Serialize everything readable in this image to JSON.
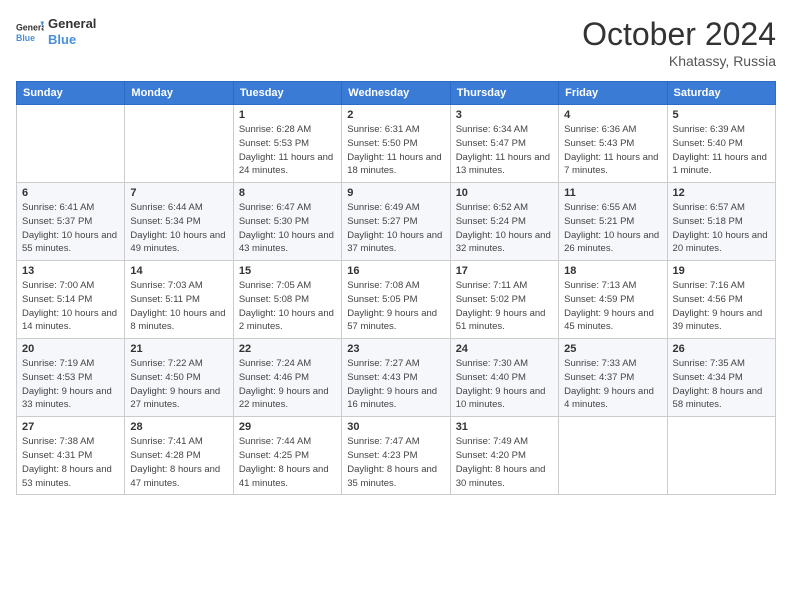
{
  "header": {
    "logo_line1": "General",
    "logo_line2": "Blue",
    "month": "October 2024",
    "location": "Khatassy, Russia"
  },
  "weekdays": [
    "Sunday",
    "Monday",
    "Tuesday",
    "Wednesday",
    "Thursday",
    "Friday",
    "Saturday"
  ],
  "weeks": [
    [
      {
        "day": "",
        "info": ""
      },
      {
        "day": "",
        "info": ""
      },
      {
        "day": "1",
        "info": "Sunrise: 6:28 AM\nSunset: 5:53 PM\nDaylight: 11 hours and 24 minutes."
      },
      {
        "day": "2",
        "info": "Sunrise: 6:31 AM\nSunset: 5:50 PM\nDaylight: 11 hours and 18 minutes."
      },
      {
        "day": "3",
        "info": "Sunrise: 6:34 AM\nSunset: 5:47 PM\nDaylight: 11 hours and 13 minutes."
      },
      {
        "day": "4",
        "info": "Sunrise: 6:36 AM\nSunset: 5:43 PM\nDaylight: 11 hours and 7 minutes."
      },
      {
        "day": "5",
        "info": "Sunrise: 6:39 AM\nSunset: 5:40 PM\nDaylight: 11 hours and 1 minute."
      }
    ],
    [
      {
        "day": "6",
        "info": "Sunrise: 6:41 AM\nSunset: 5:37 PM\nDaylight: 10 hours and 55 minutes."
      },
      {
        "day": "7",
        "info": "Sunrise: 6:44 AM\nSunset: 5:34 PM\nDaylight: 10 hours and 49 minutes."
      },
      {
        "day": "8",
        "info": "Sunrise: 6:47 AM\nSunset: 5:30 PM\nDaylight: 10 hours and 43 minutes."
      },
      {
        "day": "9",
        "info": "Sunrise: 6:49 AM\nSunset: 5:27 PM\nDaylight: 10 hours and 37 minutes."
      },
      {
        "day": "10",
        "info": "Sunrise: 6:52 AM\nSunset: 5:24 PM\nDaylight: 10 hours and 32 minutes."
      },
      {
        "day": "11",
        "info": "Sunrise: 6:55 AM\nSunset: 5:21 PM\nDaylight: 10 hours and 26 minutes."
      },
      {
        "day": "12",
        "info": "Sunrise: 6:57 AM\nSunset: 5:18 PM\nDaylight: 10 hours and 20 minutes."
      }
    ],
    [
      {
        "day": "13",
        "info": "Sunrise: 7:00 AM\nSunset: 5:14 PM\nDaylight: 10 hours and 14 minutes."
      },
      {
        "day": "14",
        "info": "Sunrise: 7:03 AM\nSunset: 5:11 PM\nDaylight: 10 hours and 8 minutes."
      },
      {
        "day": "15",
        "info": "Sunrise: 7:05 AM\nSunset: 5:08 PM\nDaylight: 10 hours and 2 minutes."
      },
      {
        "day": "16",
        "info": "Sunrise: 7:08 AM\nSunset: 5:05 PM\nDaylight: 9 hours and 57 minutes."
      },
      {
        "day": "17",
        "info": "Sunrise: 7:11 AM\nSunset: 5:02 PM\nDaylight: 9 hours and 51 minutes."
      },
      {
        "day": "18",
        "info": "Sunrise: 7:13 AM\nSunset: 4:59 PM\nDaylight: 9 hours and 45 minutes."
      },
      {
        "day": "19",
        "info": "Sunrise: 7:16 AM\nSunset: 4:56 PM\nDaylight: 9 hours and 39 minutes."
      }
    ],
    [
      {
        "day": "20",
        "info": "Sunrise: 7:19 AM\nSunset: 4:53 PM\nDaylight: 9 hours and 33 minutes."
      },
      {
        "day": "21",
        "info": "Sunrise: 7:22 AM\nSunset: 4:50 PM\nDaylight: 9 hours and 27 minutes."
      },
      {
        "day": "22",
        "info": "Sunrise: 7:24 AM\nSunset: 4:46 PM\nDaylight: 9 hours and 22 minutes."
      },
      {
        "day": "23",
        "info": "Sunrise: 7:27 AM\nSunset: 4:43 PM\nDaylight: 9 hours and 16 minutes."
      },
      {
        "day": "24",
        "info": "Sunrise: 7:30 AM\nSunset: 4:40 PM\nDaylight: 9 hours and 10 minutes."
      },
      {
        "day": "25",
        "info": "Sunrise: 7:33 AM\nSunset: 4:37 PM\nDaylight: 9 hours and 4 minutes."
      },
      {
        "day": "26",
        "info": "Sunrise: 7:35 AM\nSunset: 4:34 PM\nDaylight: 8 hours and 58 minutes."
      }
    ],
    [
      {
        "day": "27",
        "info": "Sunrise: 7:38 AM\nSunset: 4:31 PM\nDaylight: 8 hours and 53 minutes."
      },
      {
        "day": "28",
        "info": "Sunrise: 7:41 AM\nSunset: 4:28 PM\nDaylight: 8 hours and 47 minutes."
      },
      {
        "day": "29",
        "info": "Sunrise: 7:44 AM\nSunset: 4:25 PM\nDaylight: 8 hours and 41 minutes."
      },
      {
        "day": "30",
        "info": "Sunrise: 7:47 AM\nSunset: 4:23 PM\nDaylight: 8 hours and 35 minutes."
      },
      {
        "day": "31",
        "info": "Sunrise: 7:49 AM\nSunset: 4:20 PM\nDaylight: 8 hours and 30 minutes."
      },
      {
        "day": "",
        "info": ""
      },
      {
        "day": "",
        "info": ""
      }
    ]
  ]
}
